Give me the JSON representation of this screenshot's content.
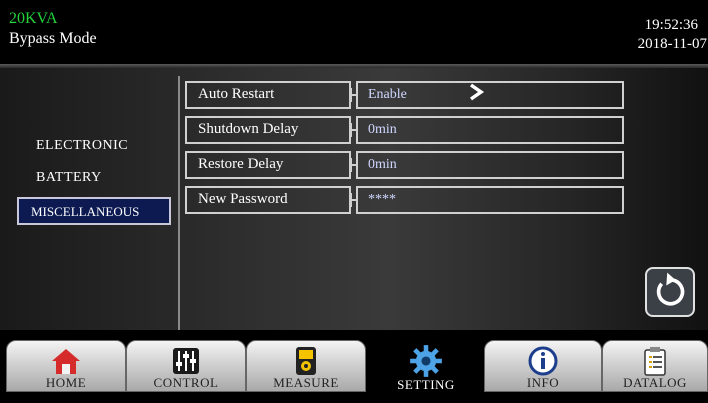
{
  "header": {
    "model": "20KVA",
    "mode": "Bypass Mode",
    "time": "19:52:36",
    "date": "2018-11-07"
  },
  "sidebar": {
    "items": [
      {
        "label": "ELECTRONIC",
        "selected": false
      },
      {
        "label": "BATTERY",
        "selected": false
      },
      {
        "label": "MISCELLANEOUS",
        "selected": true
      }
    ]
  },
  "settings": {
    "rows": [
      {
        "label": "Auto Restart",
        "value": "Enable"
      },
      {
        "label": "Shutdown Delay",
        "value": "0min"
      },
      {
        "label": "Restore Delay",
        "value": "0min"
      },
      {
        "label": "New Password",
        "value": "****"
      }
    ]
  },
  "icons": {
    "next": "chevron-right-icon",
    "back": "refresh-back-icon"
  },
  "tabs": [
    {
      "label": "HOME",
      "icon": "home-icon"
    },
    {
      "label": "CONTROL",
      "icon": "sliders-icon"
    },
    {
      "label": "MEASURE",
      "icon": "meter-icon"
    },
    {
      "label": "SETTING",
      "icon": "gear-icon",
      "active": true
    },
    {
      "label": "INFO",
      "icon": "info-icon"
    },
    {
      "label": "DATALOG",
      "icon": "clipboard-icon"
    }
  ],
  "colors": {
    "model_text": "#22d33a",
    "selected_bg": "#0d1a52"
  }
}
